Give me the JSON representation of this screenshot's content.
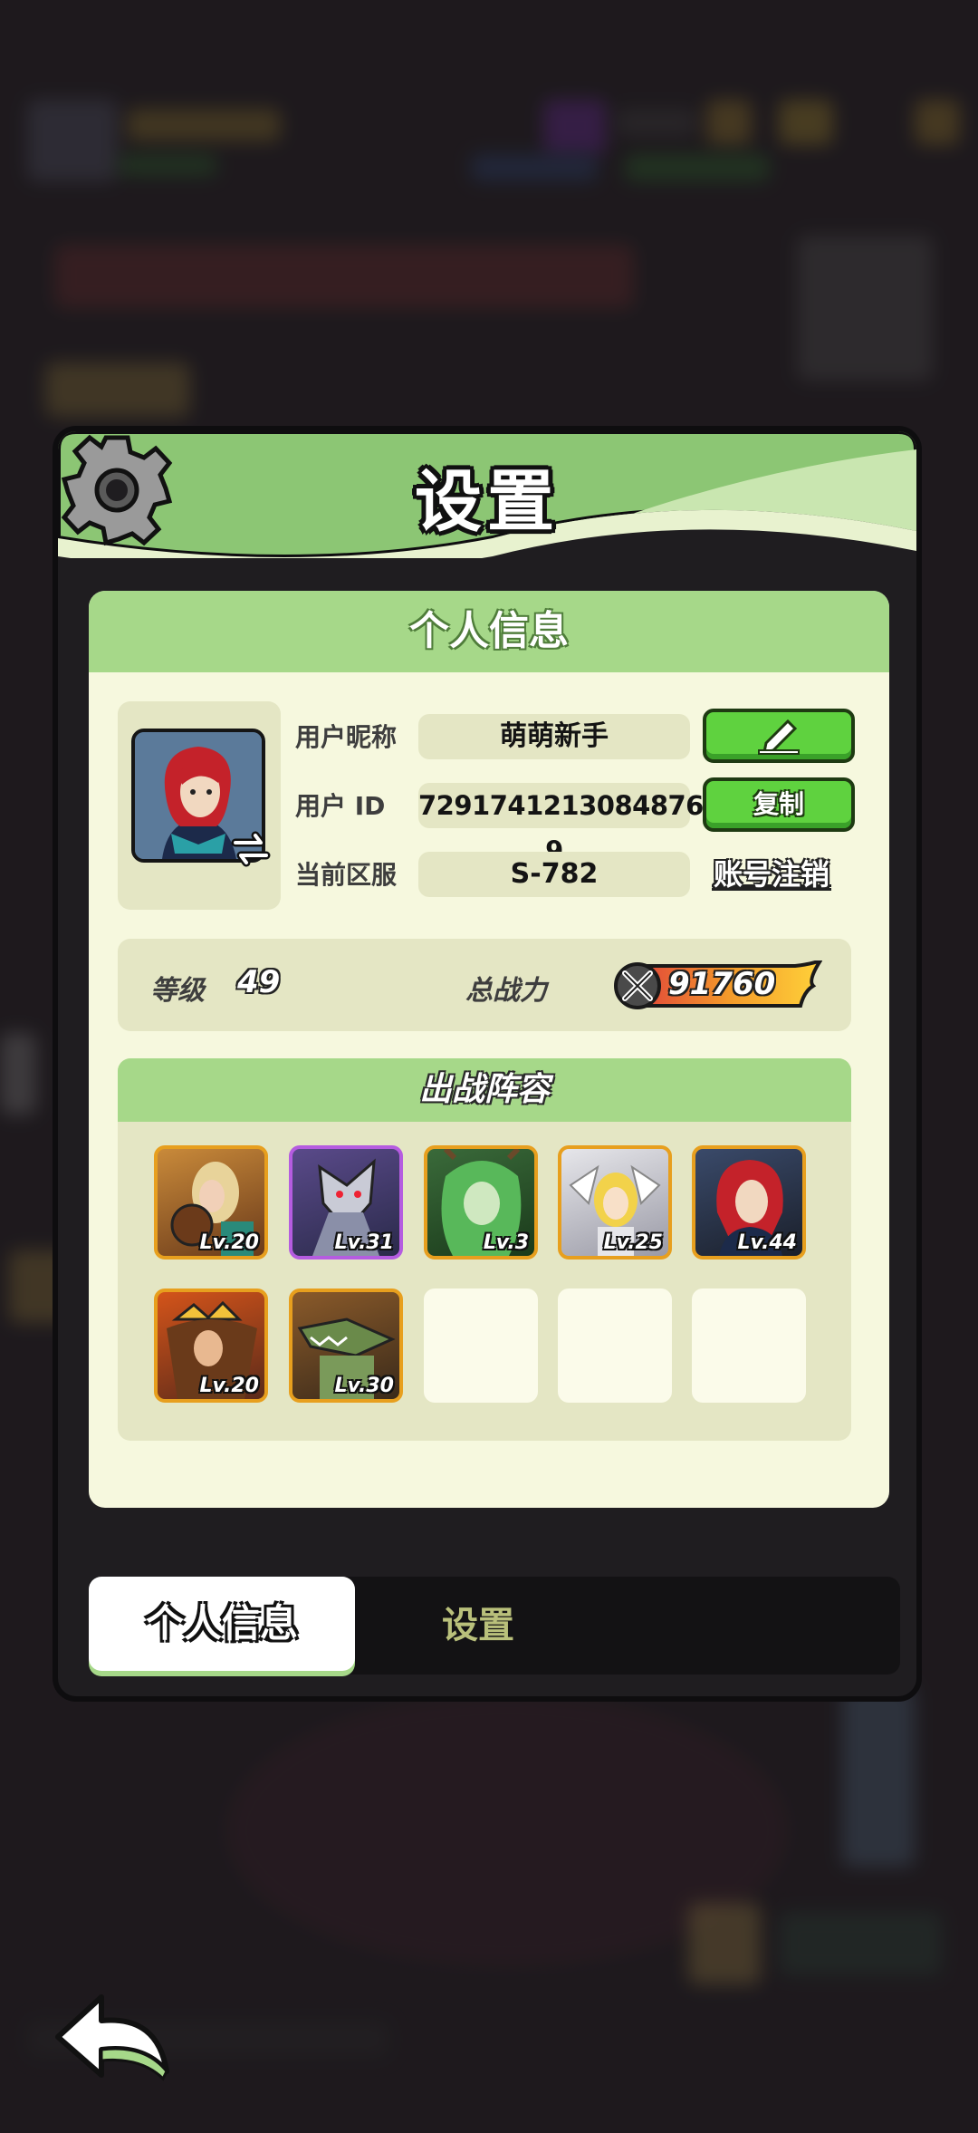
{
  "dialog": {
    "title": "设置",
    "section_title": "个人信息",
    "profile": {
      "nickname_label": "用户昵称",
      "nickname_value": "萌萌新手",
      "id_label": "用户  ID",
      "id_value": "7291741213084876 9",
      "server_label": "当前区服",
      "server_value": "S-782",
      "copy_button": "复制",
      "account_cancel_link": "账号注销"
    },
    "stats": {
      "level_label": "等级",
      "level_value": "49",
      "power_label": "总战力",
      "power_value": "91760"
    },
    "team": {
      "title": "出战阵容",
      "heroes": [
        {
          "level": "Lv.20",
          "frame": "gold"
        },
        {
          "level": "Lv.31",
          "frame": "purple"
        },
        {
          "level": "Lv.3",
          "frame": "gold"
        },
        {
          "level": "Lv.25",
          "frame": "gold"
        },
        {
          "level": "Lv.44",
          "frame": "gold"
        },
        {
          "level": "Lv.20",
          "frame": "gold"
        },
        {
          "level": "Lv.30",
          "frame": "gold"
        }
      ],
      "empty_slots": 3
    },
    "tabs": {
      "active": "个人信息",
      "inactive": "设置"
    }
  },
  "colors": {
    "accent_green": "#a6d889",
    "button_green": "#5fd23f",
    "panel_bg": "#f6f8de"
  },
  "icons": [
    "gear-icon",
    "edit-pencil-icon",
    "switch-arrows-icon",
    "sword-power-icon",
    "back-arrow-icon"
  ]
}
